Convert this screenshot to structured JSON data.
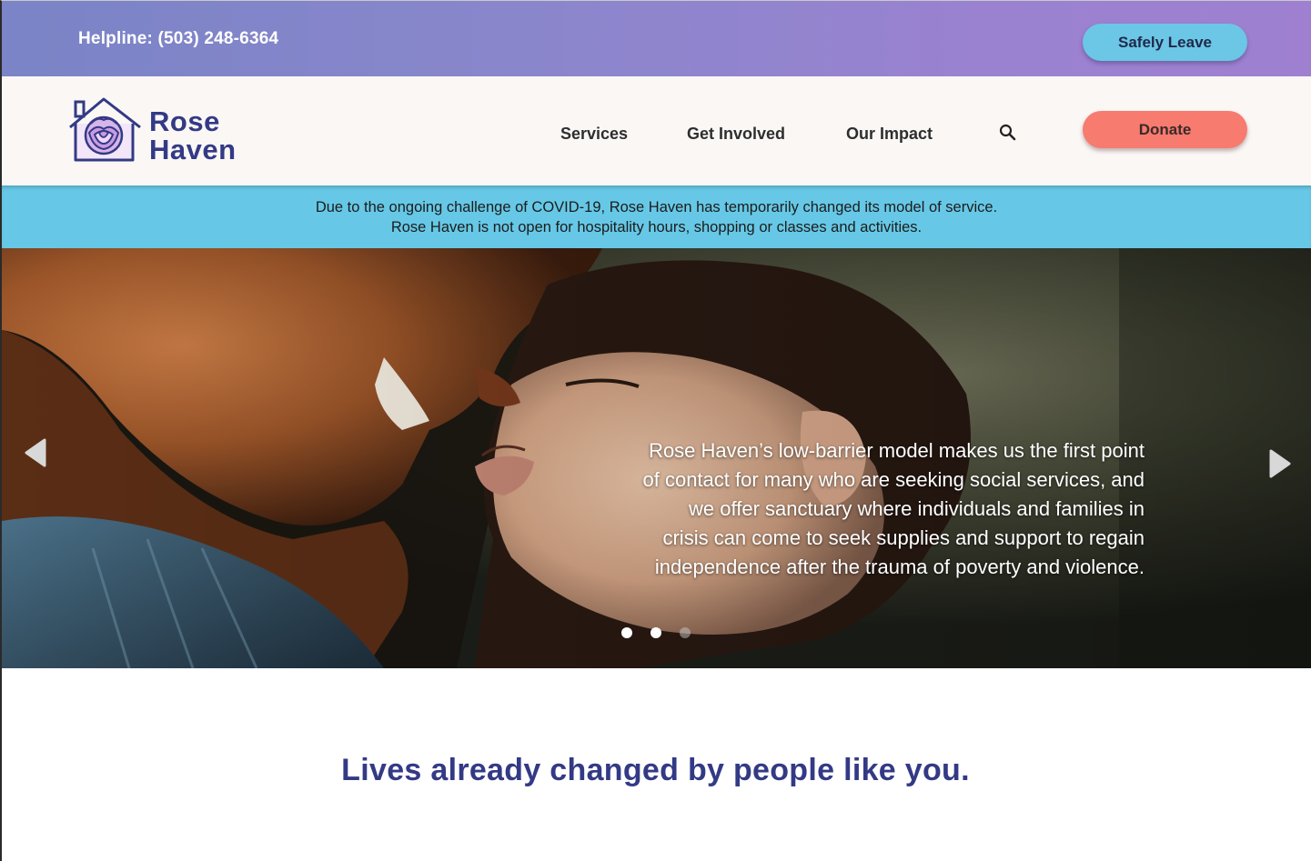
{
  "topbar": {
    "helpline": "Helpline: (503) 248-6364",
    "safely_leave": "Safely Leave"
  },
  "header": {
    "logo_line1": "Rose",
    "logo_line2": "Haven",
    "nav": [
      "Services",
      "Get Involved",
      "Our Impact"
    ],
    "search_icon": "search-icon",
    "donate": "Donate"
  },
  "notice": {
    "line1": "Due to the ongoing challenge of COVID-19, Rose Haven has temporarily changed its model of service.",
    "line2": "Rose Haven is not open for hospitality hours, shopping or classes and activities."
  },
  "hero": {
    "caption": "Rose Haven’s low-barrier model makes us the first point of contact for many who are seeking social services, and we offer sanctuary where individuals and families in crisis can come to seek supplies and support to regain independence after the trauma of poverty and violence.",
    "slides": 3,
    "active_slide": 1
  },
  "tagline": "Lives already changed by people like you.",
  "colors": {
    "brand_navy": "#333a85",
    "safely_leave_bg": "#6cc6e6",
    "donate_bg": "#f77b6f",
    "notice_bg": "#66c8e6"
  }
}
